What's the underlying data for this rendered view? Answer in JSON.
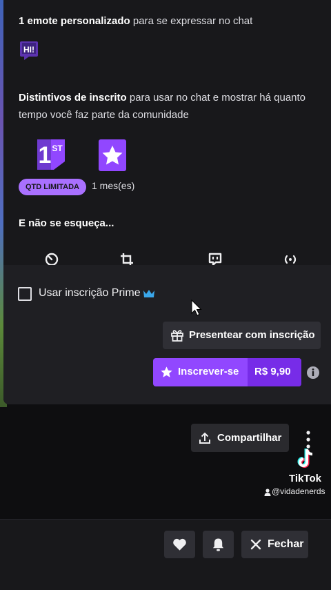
{
  "benefits": {
    "emote_bold": "1 emote personalizado",
    "emote_rest": "para se expressar no chat",
    "emote_text": "HI!",
    "badges_bold": "Distintivos de inscrito",
    "badges_rest1": "para usar no chat e mostrar há quanto",
    "badges_rest2": "tempo você faz parte da comunidade",
    "badge_first_text": "1ST",
    "limited_pill": "QTD LIMITADA",
    "month_label": "1 mes(es)",
    "dont_forget": "E não se esqueça..."
  },
  "icons_row": [
    "clock-icon",
    "crop-icon",
    "chat-icon",
    "broadcast-icon"
  ],
  "prime": {
    "label": "Usar inscrição Prime",
    "checked": false
  },
  "actions": {
    "gift_label": "Presentear com inscrição",
    "subscribe_label": "Inscrever-se",
    "price": "R$ 9,90",
    "share_label": "Compartilhar",
    "close_label": "Fechar"
  },
  "watermark": {
    "brand": "TikTok",
    "handle": "@vidadenerds"
  },
  "colors": {
    "accent": "#9147ff",
    "accent_dark": "#772ce8",
    "pill": "#a970ff",
    "prime_crown": "#3aa7ea"
  }
}
